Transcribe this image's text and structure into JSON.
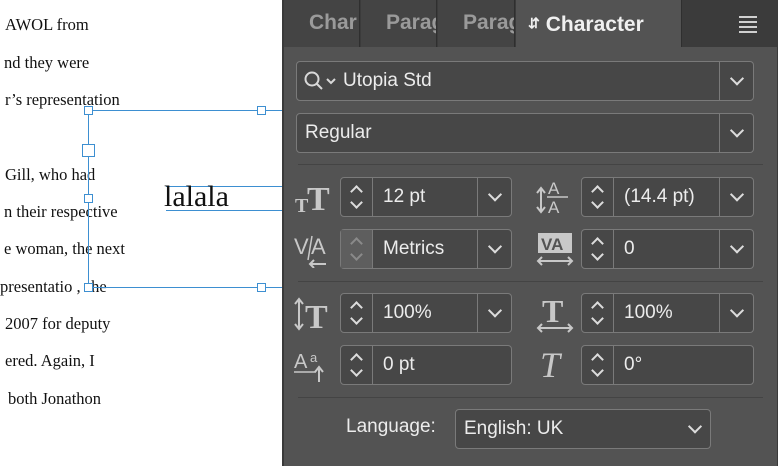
{
  "document": {
    "lines": [
      "AWOL from",
      "nd they were",
      "r’s representation",
      "Gill, who had",
      "n their respective",
      "e woman, the next",
      "presentatio , she",
      "2007 for deputy",
      "ered. Again, I",
      "both Jonathon"
    ],
    "frame_text": "lalala"
  },
  "panel": {
    "tabs": [
      "Char",
      "Parag",
      "Parag",
      "Character"
    ],
    "active_tab": "Character",
    "font_family": "Utopia Std",
    "font_style": "Regular",
    "font_size": "12 pt",
    "leading": "(14.4 pt)",
    "kerning": "Metrics",
    "tracking": "0",
    "vertical_scale": "100%",
    "horizontal_scale": "100%",
    "baseline_shift": "0 pt",
    "skew": "0°",
    "language_label": "Language:",
    "language": "English: UK"
  },
  "icons": {
    "search": "search-icon",
    "font_size": "font-size-icon",
    "leading": "leading-icon",
    "kerning": "kerning-icon",
    "tracking": "tracking-icon",
    "vertical_scale": "vertical-scale-icon",
    "horizontal_scale": "horizontal-scale-icon",
    "baseline_shift": "baseline-shift-icon",
    "skew": "skew-icon",
    "menu": "hamburger-menu-icon"
  },
  "colors": {
    "panel_bg": "#535353",
    "tab_bar_bg": "#3b3b3b",
    "field_bg": "#474747",
    "field_border": "#7a7a7a",
    "selection_frame": "#3d8fd1"
  }
}
